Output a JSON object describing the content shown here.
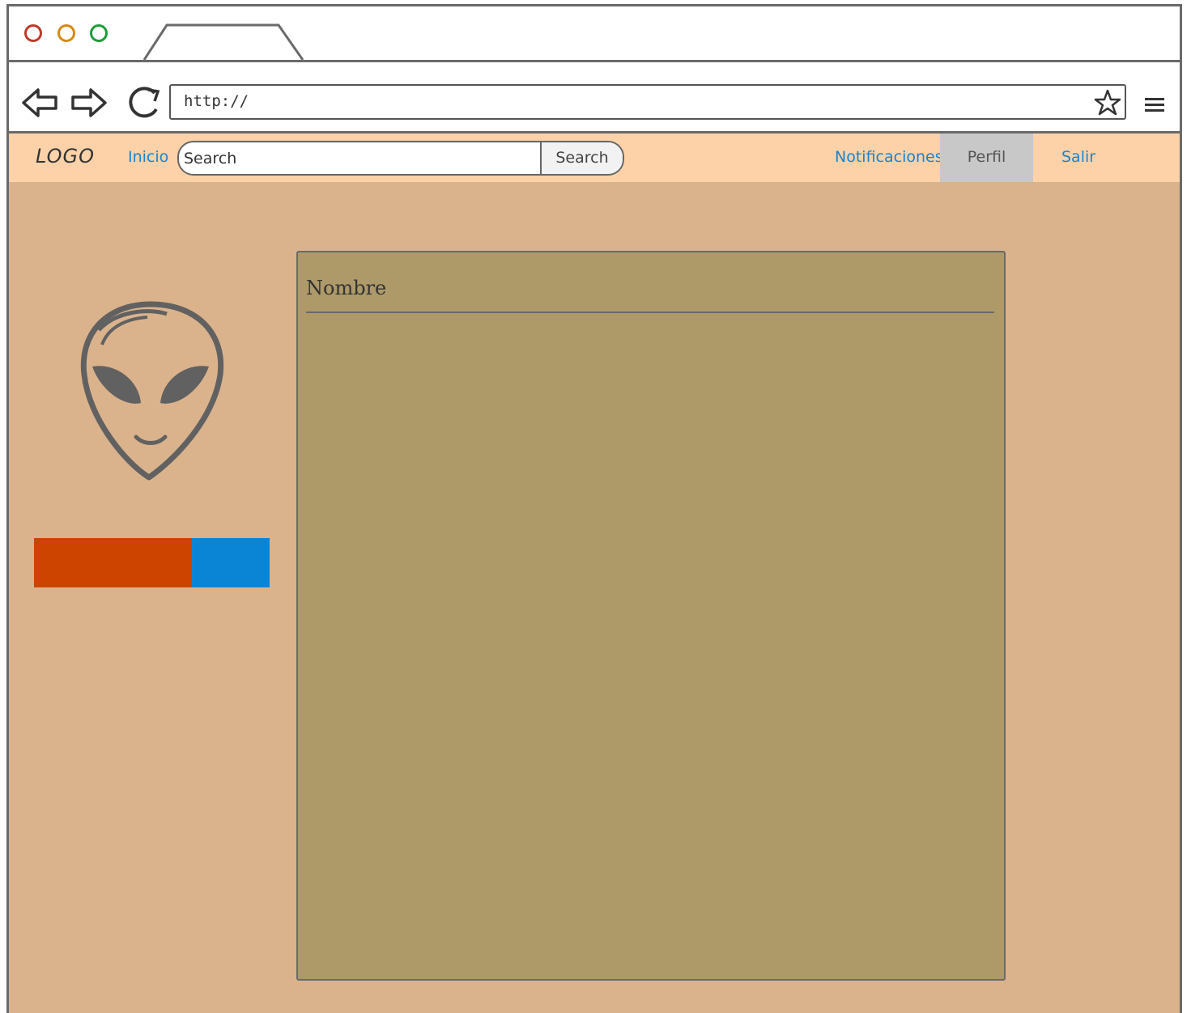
{
  "browser": {
    "url": "http://"
  },
  "navbar": {
    "logo": "LOGO",
    "home_link": "Inicio",
    "search_placeholder": "Search",
    "search_button": "Search",
    "notifications_link": "Notificaciones",
    "profile_link": "Perfil",
    "logout_link": "Salir"
  },
  "sidebar": {
    "avatar_icon": "alien-icon",
    "progress_fraction": 0.67
  },
  "panel": {
    "title": "Nombre"
  },
  "colors": {
    "page_background": "#dab38c",
    "nav_background": "#fdd2a8",
    "panel_background": "#ae9a68",
    "link": "#1a84d1",
    "progress_fill": "#cc4400",
    "progress_track": "#0a85d6",
    "profile_highlight": "#c8c8c8"
  }
}
